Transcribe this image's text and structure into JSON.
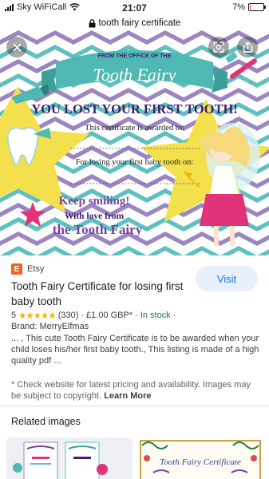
{
  "status_bar": {
    "carrier": "Sky WiFiCall",
    "time": "21:07",
    "battery": "7%",
    "battery_level": 0.07
  },
  "url_bar": {
    "lock_icon": "lock-icon",
    "text": "tooth fairy certificate"
  },
  "hero_image": {
    "office_line": "FROM THE OFFICE OF THE",
    "banner_title": "Tooth Fairy",
    "headline": "YOU LOST YOUR FIRST TOOTH!",
    "awarded_line": "This certificate is awarded to:",
    "reason_line": "For losing your first baby tooth on:",
    "closing_1": "Keep smiling!",
    "closing_2": "With love from",
    "closing_3": "the Tooth Fairy",
    "colors": {
      "chevron_purple": "#9b86c2",
      "chevron_teal": "#5fc0c0",
      "star_yellow": "#f4e04d",
      "headline_purple": "#3f1e6e",
      "banner_teal": "#4fb8b3"
    }
  },
  "overlay_buttons": {
    "close_icon": "close-icon",
    "lens_icon": "lens-icon",
    "share_icon": "share-icon"
  },
  "result": {
    "source": "Etsy",
    "source_logo_letter": "E",
    "title": "Tooth Fairy Certificate for losing first baby tooth",
    "visit_label": "Visit",
    "rating": "5",
    "stars": "★★★★★",
    "review_count": "(330)",
    "price": "£1.00 GBP*",
    "separator": "·",
    "stock": "In stock",
    "trailing_dot": "·",
    "brand": "Brand: MerryElfmas",
    "description": "... , This cute Tooth Fairy Certificate is to be awarded when your child loses his/her first baby tooth., This listing is made of a high quality pdf ...",
    "notice": "* Check website for latest pricing and availability. Images may be subject to copyright.",
    "learn_more": "Learn More"
  },
  "related": {
    "heading": "Related images",
    "thumb_2_title": "Tooth Fairy Certificate"
  }
}
